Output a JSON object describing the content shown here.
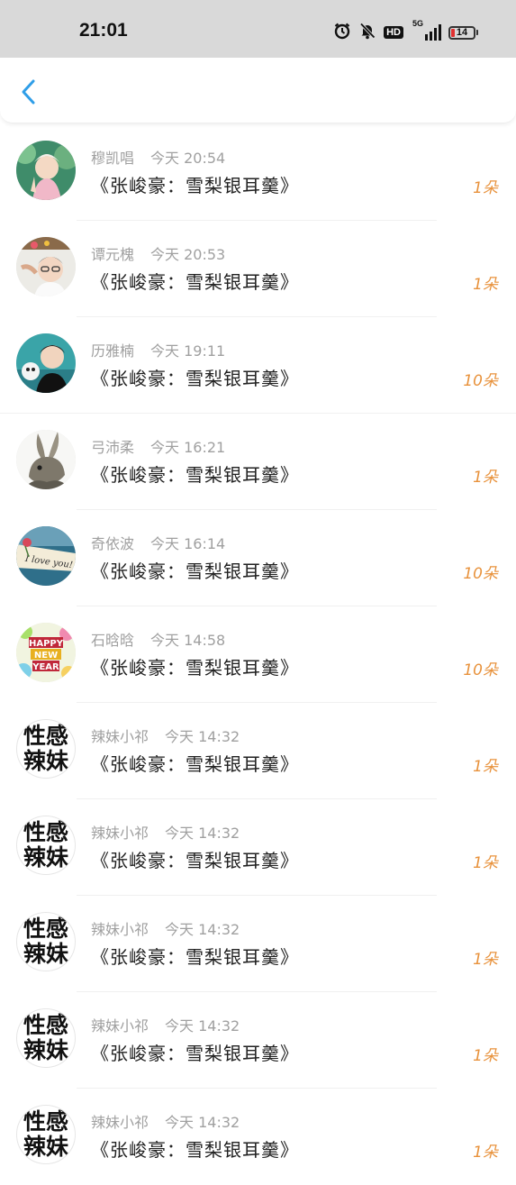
{
  "status_bar": {
    "time": "21:01",
    "network": "5G",
    "hd": "HD",
    "battery": "14",
    "icons": [
      "alarm-icon",
      "bell-off-icon",
      "hd-icon",
      "signal-5g-icon",
      "battery-icon"
    ]
  },
  "header": {
    "back_icon": "chevron-left-icon",
    "accent": "#2f9ee8"
  },
  "count_color": "#e8923c",
  "gifts": [
    {
      "user": "穆凯唱",
      "time": "今天 20:54",
      "message": "《张峻豪：雪梨银耳羹》",
      "count": "1朵",
      "avatar": "photo-girl"
    },
    {
      "user": "谭元槐",
      "time": "今天 20:53",
      "message": "《张峻豪：雪梨银耳羹》",
      "count": "1朵",
      "avatar": "photo-boy-glasses"
    },
    {
      "user": "历雅楠",
      "time": "今天 19:11",
      "message": "《张峻豪：雪梨银耳羹》",
      "count": "10朵",
      "avatar": "photo-boy-teal"
    },
    {
      "user": "弓沛柔",
      "time": "今天 16:21",
      "message": "《张峻豪：雪梨银耳羹》",
      "count": "1朵",
      "avatar": "photo-rabbit"
    },
    {
      "user": "奇依波",
      "time": "今天 16:14",
      "message": "《张峻豪：雪梨银耳羹》",
      "count": "10朵",
      "avatar": "photo-i-love-you"
    },
    {
      "user": "石晗晗",
      "time": "今天 14:58",
      "message": "《张峻豪：雪梨银耳羹》",
      "count": "10朵",
      "avatar": "photo-happy-new-year"
    },
    {
      "user": "辣妹小祁",
      "time": "今天 14:32",
      "message": "《张峻豪：雪梨银耳羹》",
      "count": "1朵",
      "avatar_text": [
        "性感",
        "辣妹"
      ]
    },
    {
      "user": "辣妹小祁",
      "time": "今天 14:32",
      "message": "《张峻豪：雪梨银耳羹》",
      "count": "1朵",
      "avatar_text": [
        "性感",
        "辣妹"
      ]
    },
    {
      "user": "辣妹小祁",
      "time": "今天 14:32",
      "message": "《张峻豪：雪梨银耳羹》",
      "count": "1朵",
      "avatar_text": [
        "性感",
        "辣妹"
      ]
    },
    {
      "user": "辣妹小祁",
      "time": "今天 14:32",
      "message": "《张峻豪：雪梨银耳羹》",
      "count": "1朵",
      "avatar_text": [
        "性感",
        "辣妹"
      ]
    },
    {
      "user": "辣妹小祁",
      "time": "今天 14:32",
      "message": "《张峻豪：雪梨银耳羹》",
      "count": "1朵",
      "avatar_text": [
        "性感",
        "辣妹"
      ]
    }
  ]
}
